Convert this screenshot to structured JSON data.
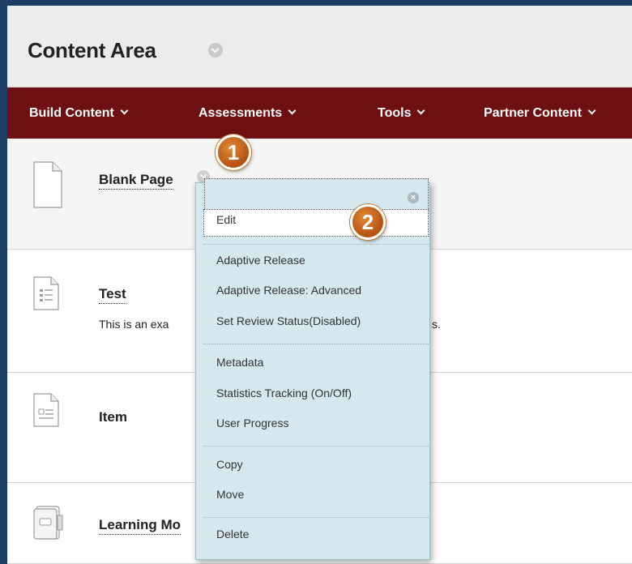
{
  "page": {
    "title": "Content Area"
  },
  "menubar": {
    "items": [
      {
        "label": "Build Content"
      },
      {
        "label": "Assessments"
      },
      {
        "label": "Tools"
      },
      {
        "label": "Partner Content"
      }
    ]
  },
  "content": {
    "items": [
      {
        "title": "Blank Page",
        "icon": "blank-page-icon",
        "description": ""
      },
      {
        "title": "Test",
        "icon": "test-icon",
        "description": "This is an exa"
      },
      {
        "title": "Item",
        "icon": "item-icon",
        "description": ""
      },
      {
        "title": "Learning Mo",
        "icon": "learning-module-icon",
        "description": ""
      }
    ],
    "test_desc_tail": "s."
  },
  "context_menu": {
    "close_glyph": "×",
    "items": [
      {
        "label": "Edit"
      },
      {
        "label": "Adaptive Release"
      },
      {
        "label": "Adaptive Release: Advanced"
      },
      {
        "label": "Set Review Status(Disabled)"
      },
      {
        "label": "Metadata"
      },
      {
        "label": "Statistics Tracking (On/Off)"
      },
      {
        "label": "User Progress"
      },
      {
        "label": "Copy"
      },
      {
        "label": "Move"
      },
      {
        "label": "Delete"
      }
    ]
  },
  "callouts": [
    {
      "number": "1"
    },
    {
      "number": "2"
    }
  ],
  "colors": {
    "menubar": "#6e0f12",
    "header": "#ececec",
    "dropdown": "#d5e8f0",
    "callout": "#c86a1f",
    "frame": "#1d3f66"
  }
}
